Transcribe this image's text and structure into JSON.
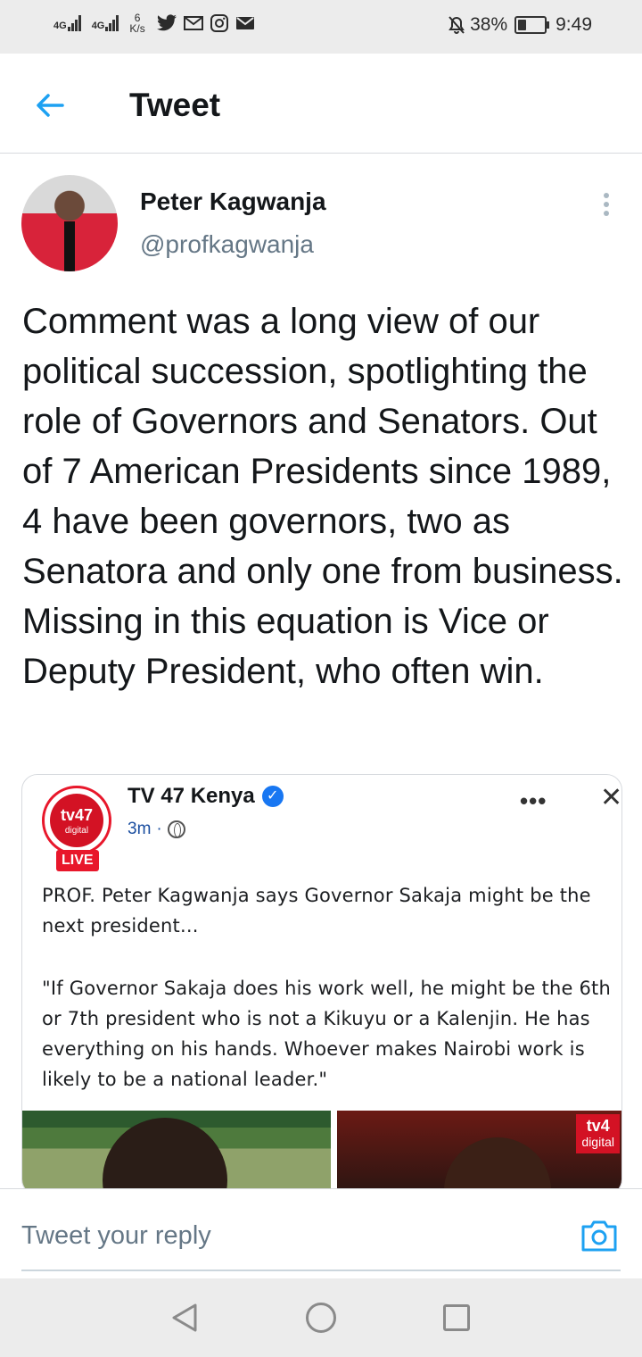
{
  "status_bar": {
    "network1": "4G",
    "network2": "4G",
    "speed_value": "6",
    "speed_unit": "K/s",
    "battery": "38%",
    "battery_level": 0.38,
    "time": "9:49",
    "icons": [
      "twitter-icon",
      "gmail-icon",
      "instagram-icon",
      "mail-icon",
      "mute-icon"
    ]
  },
  "header": {
    "title": "Tweet"
  },
  "tweet": {
    "author_name": "Peter Kagwanja",
    "author_handle": "@profkagwanja",
    "text": "Comment was a long view of our political succession, spotlighting the role of Governors and Senators. Out of 7 American Presidents since 1989, 4 have been governors, two as Senatora and only one from business. Missing in this equation is Vice or Deputy President, who often win."
  },
  "embed": {
    "logo_text": "tv47",
    "logo_sub": "digital",
    "live_label": "LIVE",
    "source_name": "TV 47 Kenya",
    "time": "3m",
    "separator": "·",
    "more": "•••",
    "close": "✕",
    "paragraph1": "PROF. Peter Kagwanja says Governor Sakaja might be the next president...",
    "paragraph2": "\"If Governor Sakaja does his work well, he might be the 6th or 7th president who is not a Kikuyu or a Kalenjin. He has everything on his hands. Whoever makes Nairobi work is likely to be a national leader.\"",
    "watermark_text": "tv4",
    "watermark_sub": "digital"
  },
  "reply": {
    "placeholder": "Tweet your reply"
  },
  "colors": {
    "accent": "#1DA1F2",
    "text": "#14171A",
    "muted": "#657786",
    "border": "#D7DADE",
    "tv_red": "#D31224"
  }
}
